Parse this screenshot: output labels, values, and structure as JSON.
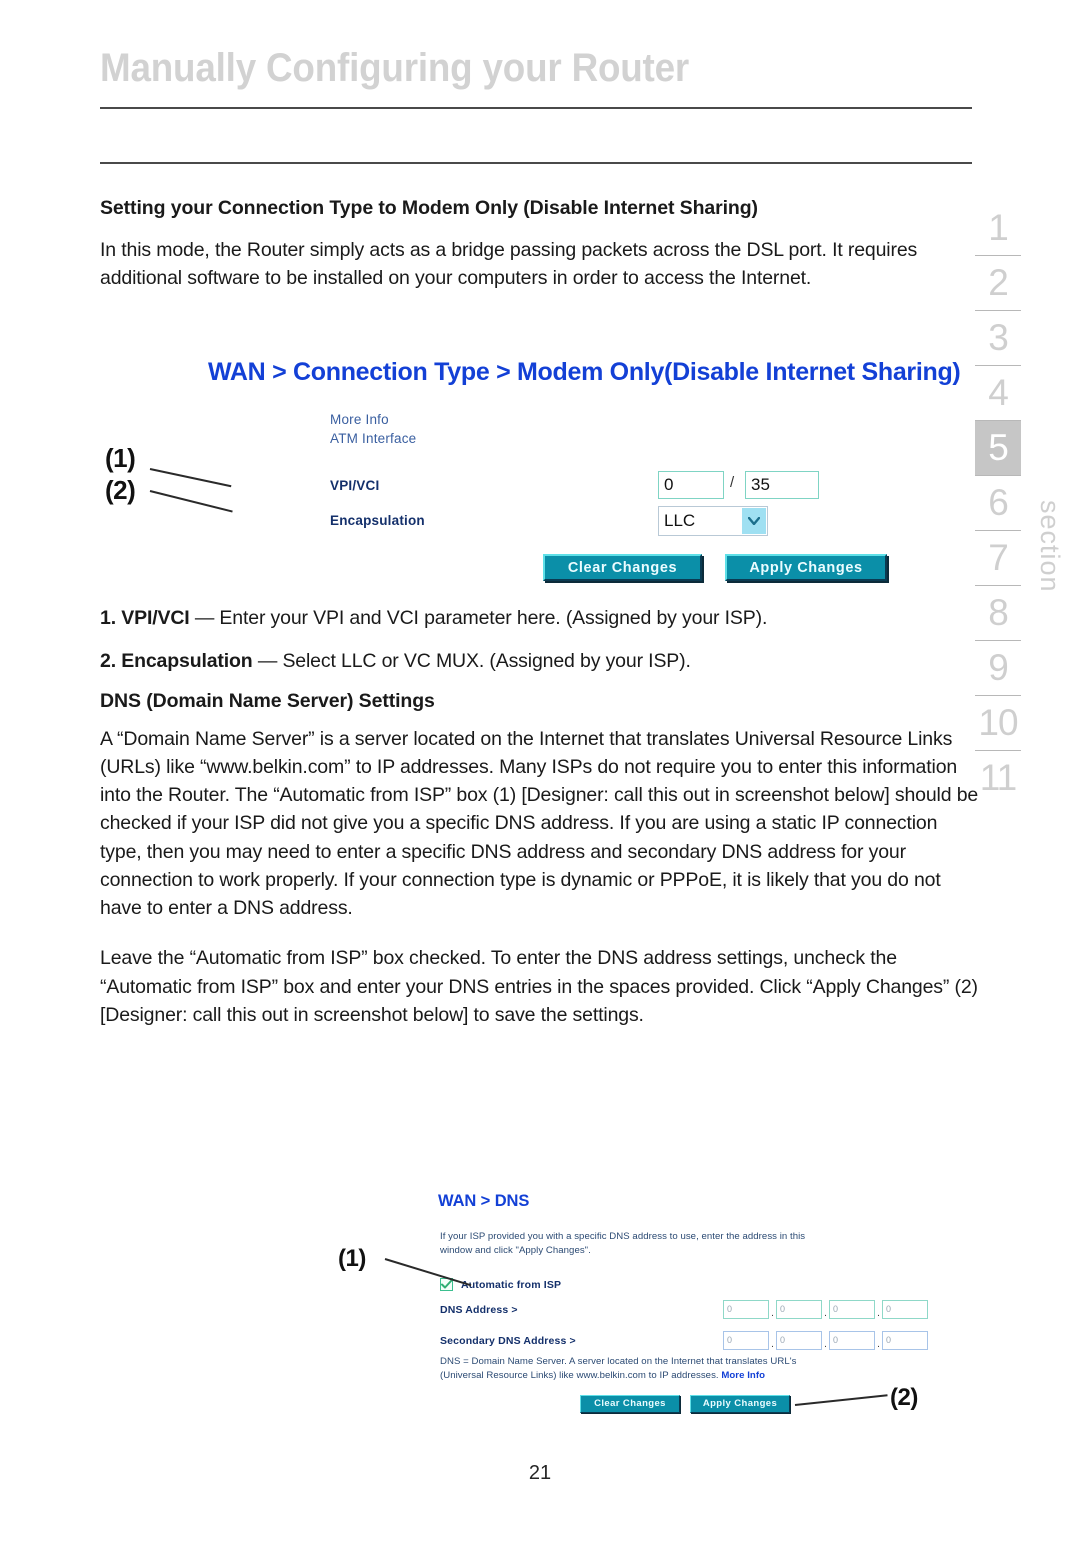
{
  "header": {
    "title": "Manually Configuring your Router"
  },
  "content": {
    "section_heading": "Setting your Connection Type to Modem Only (Disable Internet Sharing)",
    "intro_paragraph": "In this mode, the Router simply acts as a bridge passing packets across the DSL port. It requires additional software to be installed on your computers in order to access the Internet.",
    "item1_label": "1. VPI/VCI",
    "item1_text": " — Enter your VPI and VCI parameter here. (Assigned by your ISP).",
    "item2_label": "2. Encapsulation",
    "item2_text": " — Select LLC or VC MUX. (Assigned by your ISP).",
    "dns_heading": "DNS (Domain Name Server) Settings",
    "dns_paragraph": "A “Domain Name Server” is a server located on the Internet that translates Universal Resource Links (URLs) like “www.belkin.com” to IP addresses. Many ISPs do not require you to enter this information into the Router. The “Automatic from ISP” box (1) [Designer: call this out in screenshot below] should be checked if your ISP did not give you a specific DNS address. If you are using a static IP connection type, then you may need to enter a specific DNS address and secondary DNS address for your connection to work properly. If your connection type is dynamic or PPPoE, it is likely that you do not have to enter a DNS address.",
    "dns_paragraph_2": "Leave the “Automatic from ISP” box checked. To enter the DNS address settings, uncheck the “Automatic from ISP” box and enter your DNS entries in the spaces provided. Click “Apply Changes” (2) [Designer: call this out in screenshot below] to save the settings."
  },
  "router_panel_1": {
    "heading": "WAN > Connection Type > Modem Only(Disable Internet Sharing)",
    "more_info": "More Info",
    "atm_interface": "ATM Interface",
    "vpi_vci_label": "VPI/VCI",
    "encapsulation_label": "Encapsulation",
    "vpi_value": "0",
    "vci_value": "35",
    "slash": "/",
    "encapsulation_value": "LLC",
    "clear_button": "Clear Changes",
    "apply_button": "Apply Changes",
    "callout_1": "(1)",
    "callout_2": "(2)"
  },
  "router_panel_2": {
    "heading": "WAN > DNS",
    "intro": "If your ISP provided you with a specific DNS address to use, enter the address in this window and click \"Apply Changes\".",
    "checkbox_label": "Automatic from ISP",
    "dns_address_label": "DNS Address >",
    "secondary_dns_label": "Secondary DNS Address >",
    "dns_octets": [
      "0",
      "0",
      "0",
      "0"
    ],
    "secondary_octets": [
      "0",
      "0",
      "0",
      "0"
    ],
    "footnote": "DNS = Domain Name Server. A server located on the Internet that translates URL's (Universal Resource Links) like www.belkin.com to IP addresses. ",
    "footnote_link": "More Info",
    "clear_button": "Clear Changes",
    "apply_button": "Apply Changes",
    "callout_1": "(1)",
    "callout_2": "(2)"
  },
  "section_rail": {
    "word": "section",
    "items": [
      "1",
      "2",
      "3",
      "4",
      "5",
      "6",
      "7",
      "8",
      "9",
      "10",
      "11"
    ],
    "active": "5"
  },
  "page_number": "21",
  "colors": {
    "ui_blue": "#1340d6",
    "ui_label_navy": "#14306b",
    "button_teal": "#0b8fa8",
    "rail_gray": "#cfcfcf",
    "rail_active_bg": "#c6c6c6"
  }
}
